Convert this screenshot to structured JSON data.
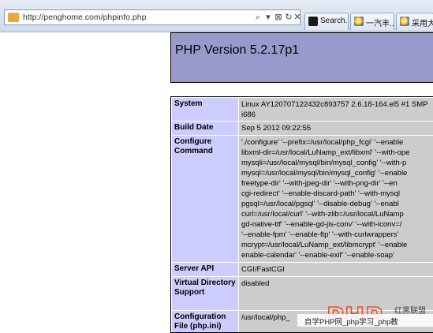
{
  "browser": {
    "address": "http://penghome.com/phpinfo.php",
    "address_buttons": [
      "⌕",
      "▾",
      "⊠",
      "↻",
      "✕"
    ],
    "tabs": [
      {
        "label": "Search..."
      },
      {
        "label": "一汽丰..."
      },
      {
        "label": "采用大..."
      }
    ]
  },
  "page": {
    "title": "PHP Version 5.2.17p1",
    "rows": [
      {
        "key": "System",
        "lines": [
          "Linux AY120707122432c893757 2.6.18-164.el5 #1 SMP",
          "i686"
        ]
      },
      {
        "key": "Build Date",
        "lines": [
          "Sep 5 2012 09:22:55"
        ]
      },
      {
        "key": "Configure Command",
        "lines": [
          "'./configure' '--prefix=/usr/local/php_fcgi' '--enable",
          "libxml-dir=/usr/local/LuNamp_ext/libxml' '--with-ope",
          "mysqli=/usr/local/mysql/bin/mysql_config' '--with-p",
          "mysql=/usr/local/mysql/bin/mysql_config' '--enable",
          "freetype-dir' '--with-jpeg-dir' '--with-png-dir' '--en",
          "cgi-redirect' '--enable-discard-path' '--with-mysql",
          "pgsql=/usr/local/pgsql' '--disable-debug' '--enabl",
          "curl=/usr/local/curl' '--with-zlib=/usr/local/LuNamp",
          "gd-native-ttf' '--enable-gd-jis-conv' '--with-iconv=/",
          "'--enable-fpm' '--enable-ftp' '--with-curlwrappers'",
          "mcrypt=/usr/local/LuNamp_ext/libmcrypt' '--enable",
          "enable-calendar' '--enable-exif' '--enable-soap'"
        ]
      },
      {
        "key": "Server API",
        "lines": [
          "CGI/FastCGI"
        ]
      },
      {
        "key": "Virtual Directory Support",
        "lines": [
          "disabled"
        ]
      },
      {
        "key": "Configuration File (php.ini)",
        "lines": [
          "/usr/local/php_"
        ]
      }
    ]
  },
  "watermark": {
    "logo": "PHP",
    "site_cn": "红黑联盟",
    "caption": "自学PHP网_php学习_php教"
  }
}
